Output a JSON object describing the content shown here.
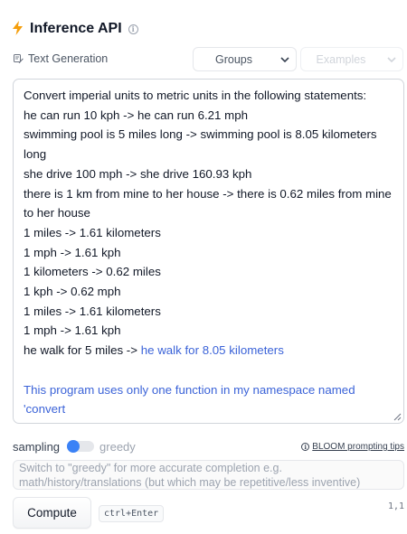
{
  "header": {
    "title": "Inference API",
    "bolt_color": "#f59e0b"
  },
  "task": {
    "label": "Text Generation"
  },
  "selects": {
    "groups": "Groups",
    "examples": "Examples"
  },
  "editor": {
    "prompt_lines": [
      "Convert imperial units to metric units in the following statements:",
      "he can run 10 kph -> he can run 6.21 mph",
      "swimming pool is 5 miles long -> swimming pool is 8.05 kilometers long",
      "she drive 100 mph -> she drive 160.93 kph",
      "there is 1 km from mine to her house -> there is 0.62 miles from mine to her house",
      "1 miles -> 1.61 kilometers",
      "1 mph -> 1.61 kph",
      "1 kilometers -> 0.62 miles",
      "1 kph -> 0.62 mph",
      "1 miles -> 1.61 kilometers",
      "1 mph -> 1.61 kph"
    ],
    "last_prompt": "he walk for 5 miles -> ",
    "completion_inline": "he walk for 8.05 kilometers",
    "completion_block": "This program uses only one function in my namespace named 'convert",
    "completion_color": "#3b63d8"
  },
  "sampling": {
    "left_label": "sampling",
    "right_label": "greedy",
    "selected": "sampling",
    "accent_color": "#3b82f6"
  },
  "tips": {
    "label": "BLOOM prompting tips"
  },
  "hint": {
    "text": "Switch to \"greedy\" for more accurate completion e.g. math/history/translations (but which may be repetitive/less inventive)"
  },
  "compute": {
    "button_label": "Compute",
    "shortcut": "ctrl+Enter"
  },
  "cursor_position": "1,1"
}
